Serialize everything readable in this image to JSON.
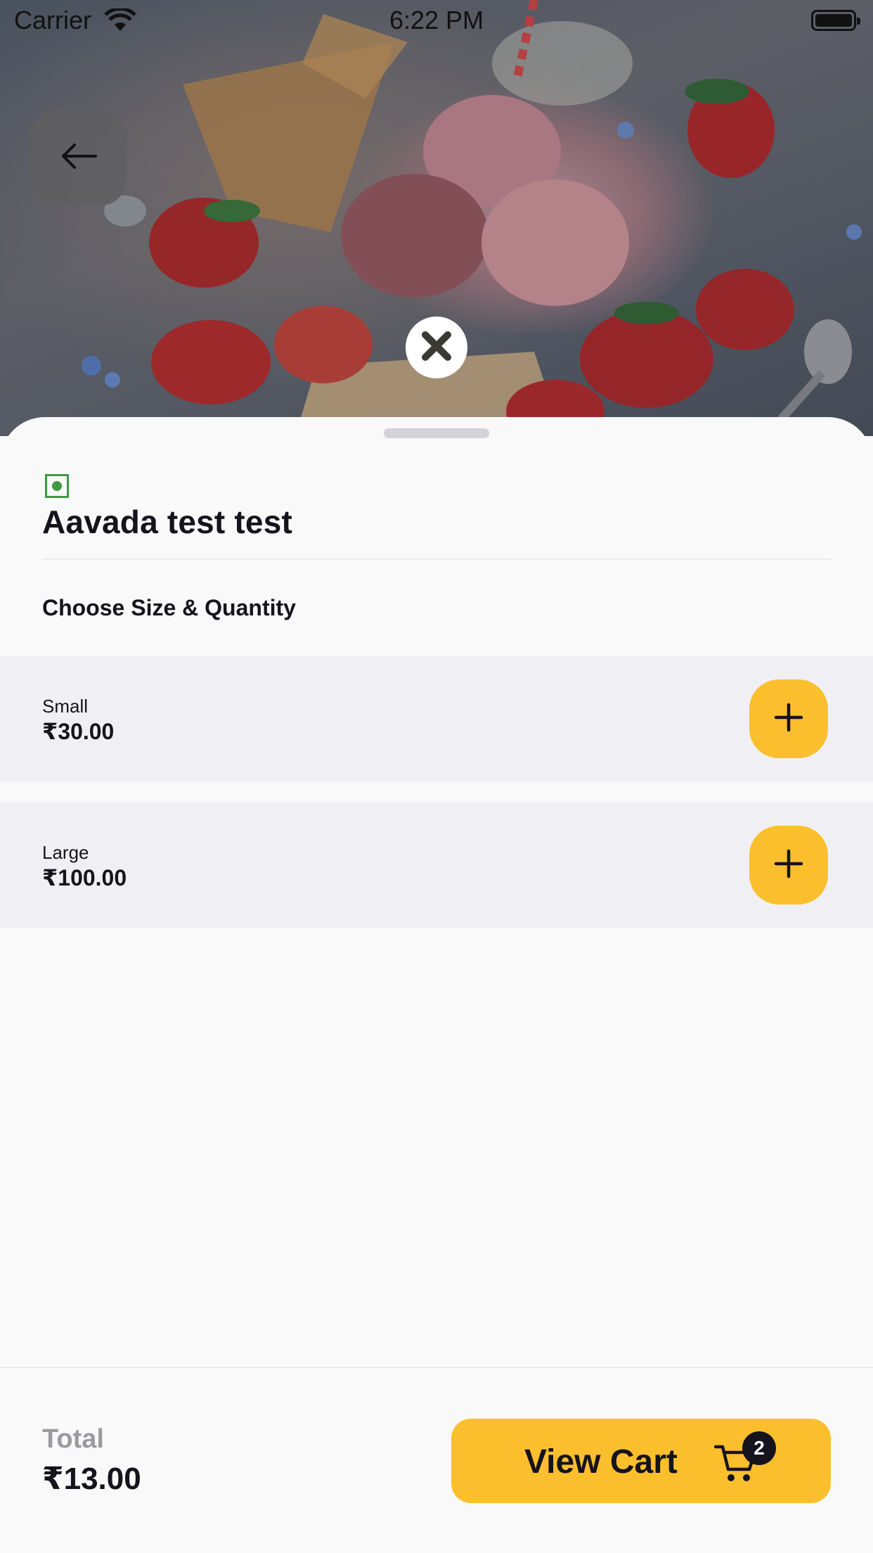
{
  "status_bar": {
    "carrier": "Carrier",
    "time": "6:22 PM"
  },
  "hero": {
    "icons": {
      "back": "arrow-left-icon",
      "close": "close-icon"
    }
  },
  "item": {
    "veg_indicator": "veg-icon",
    "title": "Aavada test test"
  },
  "size_section": {
    "title": "Choose Size & Quantity",
    "options": [
      {
        "name": "Small",
        "price": "₹30.00"
      },
      {
        "name": "Large",
        "price": "₹100.00"
      }
    ]
  },
  "footer": {
    "total_label": "Total",
    "total_value": "₹13.00",
    "view_cart_label": "View Cart",
    "cart_count": "2"
  },
  "colors": {
    "accent": "#fbbf2e",
    "veg_green": "#3f9a43",
    "text": "#15131c"
  }
}
